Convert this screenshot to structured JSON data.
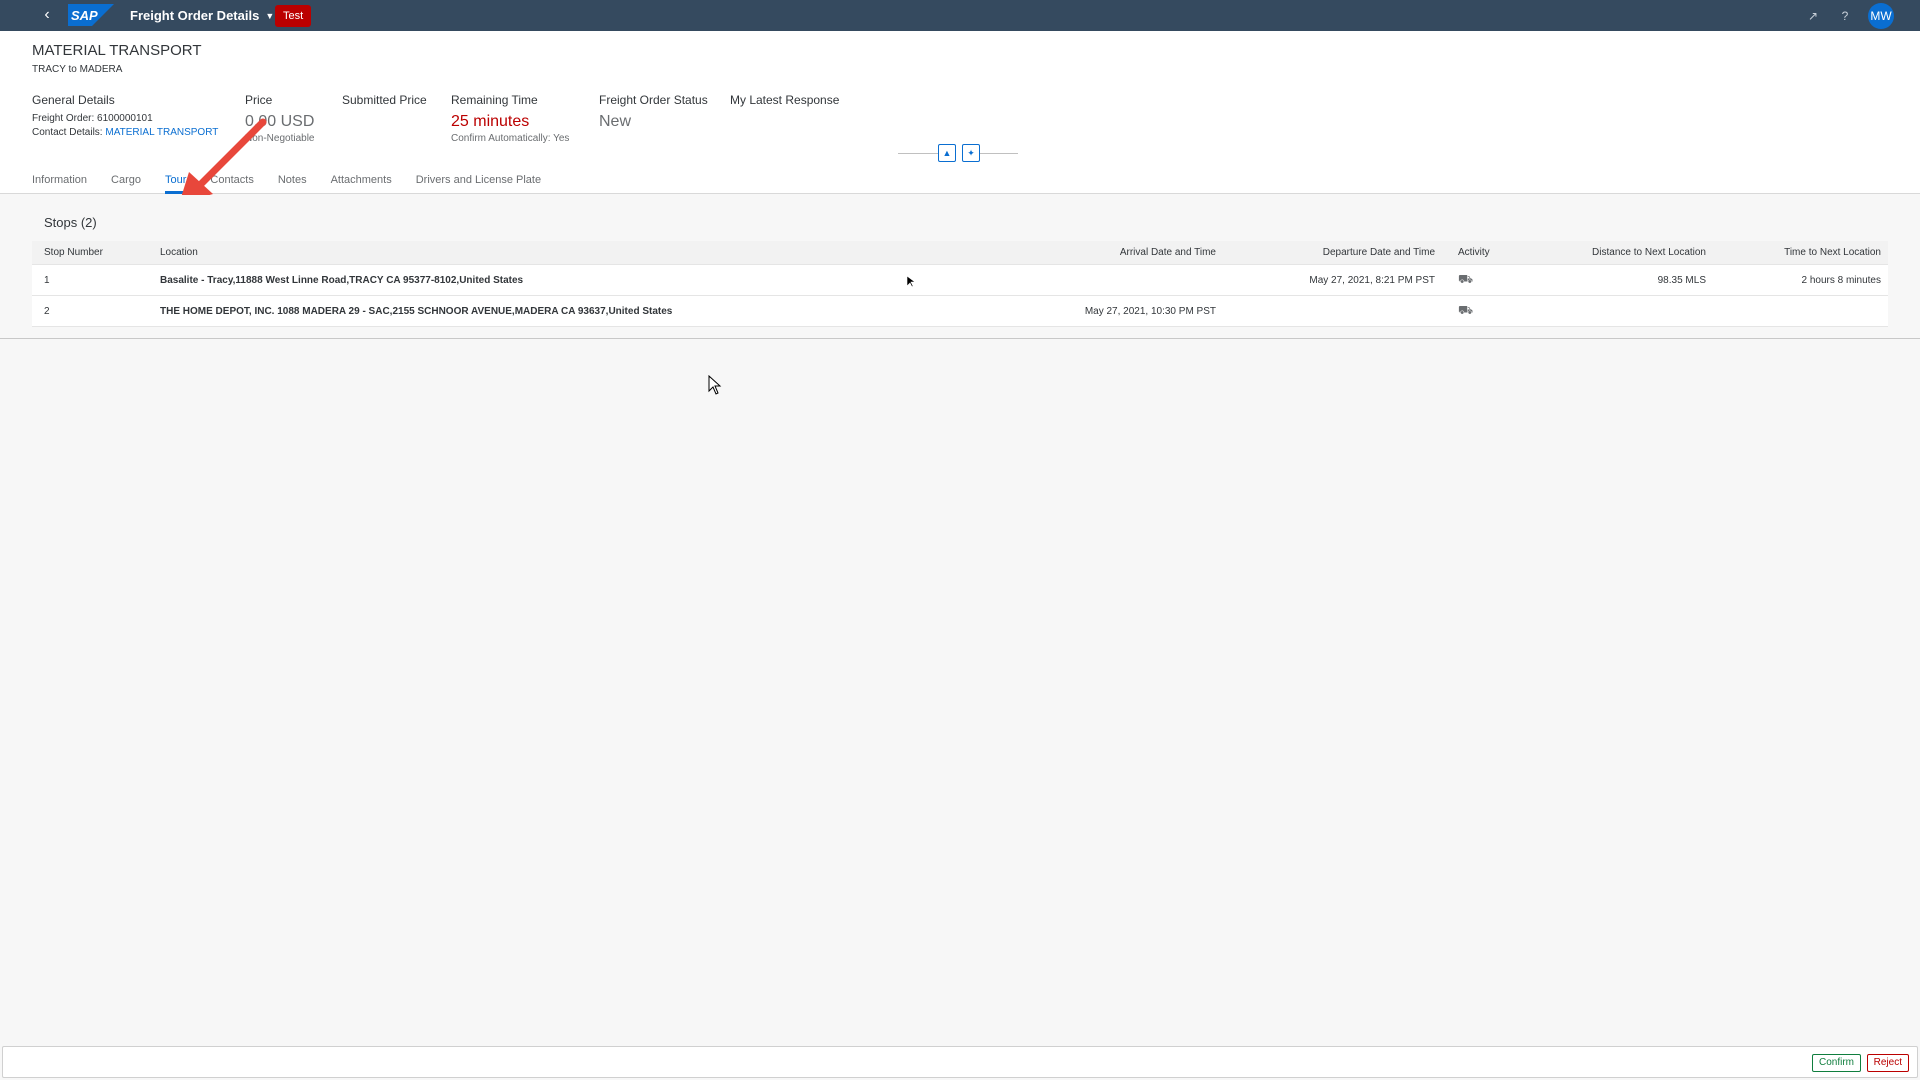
{
  "shell": {
    "logo_text": "SAP",
    "app_title": "Freight Order Details",
    "env_badge": "Test",
    "user_initials": "MW"
  },
  "header": {
    "title": "MATERIAL TRANSPORT",
    "subtitle": "TRACY to MADERA",
    "general": {
      "label": "General Details",
      "freight_order": "Freight Order: 6100000101",
      "contact_prefix": "Contact Details:",
      "contact_link": "MATERIAL TRANSPORT"
    },
    "price": {
      "label": "Price",
      "value": "0.00 USD",
      "note": "Non-Negotiable"
    },
    "submitted_price": {
      "label": "Submitted Price"
    },
    "remaining_time": {
      "label": "Remaining Time",
      "value": "25 minutes",
      "note": "Confirm Automatically: Yes"
    },
    "status": {
      "label": "Freight Order Status",
      "value": "New"
    },
    "latest_response": {
      "label": "My Latest Response"
    }
  },
  "tabs": [
    "Information",
    "Cargo",
    "Tour",
    "Contacts",
    "Notes",
    "Attachments",
    "Drivers and License Plate"
  ],
  "active_tab": "Tour",
  "stops": {
    "title": "Stops (2)",
    "columns": [
      "Stop Number",
      "Location",
      "Arrival Date and Time",
      "Departure Date and Time",
      "Activity",
      "Distance to Next Location",
      "Time to Next Location"
    ],
    "rows": [
      {
        "number": "1",
        "location": "Basalite - Tracy,11888 West Linne Road,TRACY CA 95377-8102,United States",
        "arrival": "",
        "departure": "May 27, 2021, 8:21 PM PST",
        "activity_icon": "truck-load-icon",
        "distance": "98.35  MLS",
        "time": "2 hours 8 minutes"
      },
      {
        "number": "2",
        "location": "THE HOME DEPOT, INC. 1088 MADERA 29 - SAC,2155 SCHNOOR AVENUE,MADERA CA 93637,United States",
        "arrival": "May 27, 2021, 10:30 PM PST",
        "departure": "",
        "activity_icon": "truck-load-icon",
        "distance": "",
        "time": ""
      }
    ]
  },
  "footer": {
    "confirm": "Confirm",
    "reject": "Reject"
  },
  "colors": {
    "shell": "#354a5f",
    "accent": "#0a6ed1",
    "negative": "#bb0000",
    "positive": "#107e3e"
  }
}
